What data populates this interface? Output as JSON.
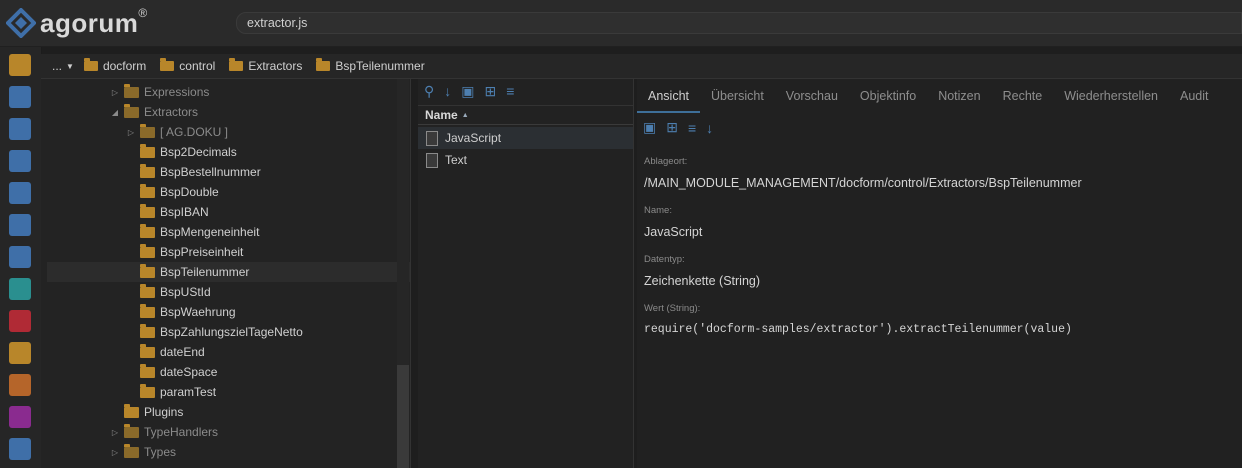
{
  "app": {
    "logo_text": "agorum",
    "logo_reg": "®"
  },
  "search": {
    "value": "extractor.js"
  },
  "rail_icons": [
    {
      "name": "folder-icon",
      "color": "#b8862a"
    },
    {
      "name": "folder-user-icon",
      "color": "#3f6fa8"
    },
    {
      "name": "grid-icon",
      "color": "#3f6fa8"
    },
    {
      "name": "clipboard-icon",
      "color": "#3f6fa8"
    },
    {
      "name": "trash-icon",
      "color": "#3f6fa8"
    },
    {
      "name": "robot-icon",
      "color": "#3f6fa8"
    },
    {
      "name": "list-icon",
      "color": "#3f6fa8"
    },
    {
      "name": "search-doc-icon",
      "color": "#2a8f8f"
    },
    {
      "name": "plugin-icon",
      "color": "#b02a35"
    },
    {
      "name": "folder-search-icon",
      "color": "#b8862a"
    },
    {
      "name": "workflow-icon",
      "color": "#b5652a"
    },
    {
      "name": "folder-purple-icon",
      "color": "#8a2b8f"
    },
    {
      "name": "document-settings-icon",
      "color": "#3f6fa8"
    }
  ],
  "breadcrumb": {
    "menu": "...",
    "items": [
      "docform",
      "control",
      "Extractors",
      "BspTeilenummer"
    ]
  },
  "tree": {
    "items": [
      {
        "label": "Expressions",
        "indent": 1,
        "arrow": "▷",
        "dim": true
      },
      {
        "label": "Extractors",
        "indent": 1,
        "arrow": "◢",
        "dim": true
      },
      {
        "label": "[ AG.DOKU ]",
        "indent": 2,
        "arrow": "▷",
        "dim": true
      },
      {
        "label": "Bsp2Decimals",
        "indent": 2,
        "arrow": ""
      },
      {
        "label": "BspBestellnummer",
        "indent": 2,
        "arrow": ""
      },
      {
        "label": "BspDouble",
        "indent": 2,
        "arrow": ""
      },
      {
        "label": "BspIBAN",
        "indent": 2,
        "arrow": ""
      },
      {
        "label": "BspMengeneinheit",
        "indent": 2,
        "arrow": ""
      },
      {
        "label": "BspPreiseinheit",
        "indent": 2,
        "arrow": ""
      },
      {
        "label": "BspTeilenummer",
        "indent": 2,
        "arrow": "",
        "selected": true
      },
      {
        "label": "BspUStId",
        "indent": 2,
        "arrow": ""
      },
      {
        "label": "BspWaehrung",
        "indent": 2,
        "arrow": ""
      },
      {
        "label": "BspZahlungszielTageNetto",
        "indent": 2,
        "arrow": ""
      },
      {
        "label": "dateEnd",
        "indent": 2,
        "arrow": ""
      },
      {
        "label": "dateSpace",
        "indent": 2,
        "arrow": ""
      },
      {
        "label": "paramTest",
        "indent": 2,
        "arrow": ""
      },
      {
        "label": "Plugins",
        "indent": 1,
        "arrow": ""
      },
      {
        "label": "TypeHandlers",
        "indent": 1,
        "arrow": "▷",
        "dim": true
      },
      {
        "label": "Types",
        "indent": 1,
        "arrow": "▷",
        "dim": true
      }
    ]
  },
  "list": {
    "header": "Name",
    "sort_indicator": "▲",
    "rows": [
      "JavaScript",
      "Text"
    ]
  },
  "detail": {
    "tabs": [
      "Ansicht",
      "Übersicht",
      "Vorschau",
      "Objektinfo",
      "Notizen",
      "Rechte",
      "Wiederherstellen",
      "Audit"
    ],
    "fields": [
      {
        "label": "Ablageort:",
        "value": "/MAIN_MODULE_MANAGEMENT/docform/control/Extractors/BspTeilenummer"
      },
      {
        "label": "Name:",
        "value": "JavaScript"
      },
      {
        "label": "Datentyp:",
        "value": "Zeichenkette (String)"
      },
      {
        "label": "Wert (String):",
        "value": "require('docform-samples/extractor').extractTeilenummer(value)"
      }
    ]
  }
}
